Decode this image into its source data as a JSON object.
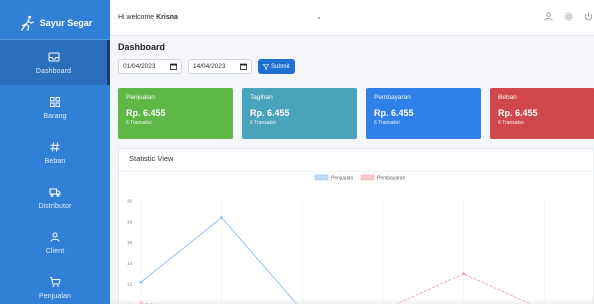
{
  "brand": {
    "name": "Sayur Segar",
    "icon": "running-person-icon"
  },
  "sidebar": {
    "items": [
      {
        "label": "Dashboard",
        "icon": "inbox-icon",
        "active": true
      },
      {
        "label": "Barang",
        "icon": "grid-icon",
        "active": false
      },
      {
        "label": "Beban",
        "icon": "hash-icon",
        "active": false
      },
      {
        "label": "Distributor",
        "icon": "truck-icon",
        "active": false
      },
      {
        "label": "Client",
        "icon": "user-icon",
        "active": false
      },
      {
        "label": "Penjualan",
        "icon": "cart-icon",
        "active": false
      }
    ]
  },
  "topbar": {
    "welcome_prefix": "Hi welcome ",
    "user_name": "Krisna",
    "icons": [
      "user-icon",
      "gear-icon",
      "power-icon"
    ]
  },
  "page": {
    "title": "Dashboard",
    "filters": {
      "start_date": "01/04/2023",
      "end_date": "14/04/2023",
      "submit_label": "Submit"
    }
  },
  "cards": [
    {
      "title": "Penjualan",
      "value": "Rp. 6.455",
      "sub": "6 Transaksi",
      "color": "#5fb745"
    },
    {
      "title": "Tagihan",
      "value": "Rp. 6.455",
      "sub": "6 Transaksi",
      "color": "#4aa3bd"
    },
    {
      "title": "Pembayaran",
      "value": "Rp. 6.455",
      "sub": "6 Transaksi",
      "color": "#2f80e8"
    },
    {
      "title": "Beban",
      "value": "Rp. 6.455",
      "sub": "6 Transaksi",
      "color": "#d0484d"
    }
  ],
  "chart": {
    "title": "Statistic View",
    "legend": [
      "Penjualan",
      "Pembayaran"
    ]
  },
  "chart_data": {
    "type": "line",
    "yticks": [
      20,
      18,
      16,
      14,
      12,
      10
    ],
    "ylim": [
      10,
      20
    ],
    "legend_position": "top-center",
    "grid": true,
    "series": [
      {
        "name": "Penjualan",
        "color": "#8fbde8",
        "values": [
          12.2,
          18.4,
          9.5,
          null,
          null,
          null
        ]
      },
      {
        "name": "Pembayaran",
        "color": "#ee9ea6",
        "values": [
          10.2,
          9.6,
          null,
          9.5,
          13.0,
          9.5
        ]
      }
    ]
  }
}
